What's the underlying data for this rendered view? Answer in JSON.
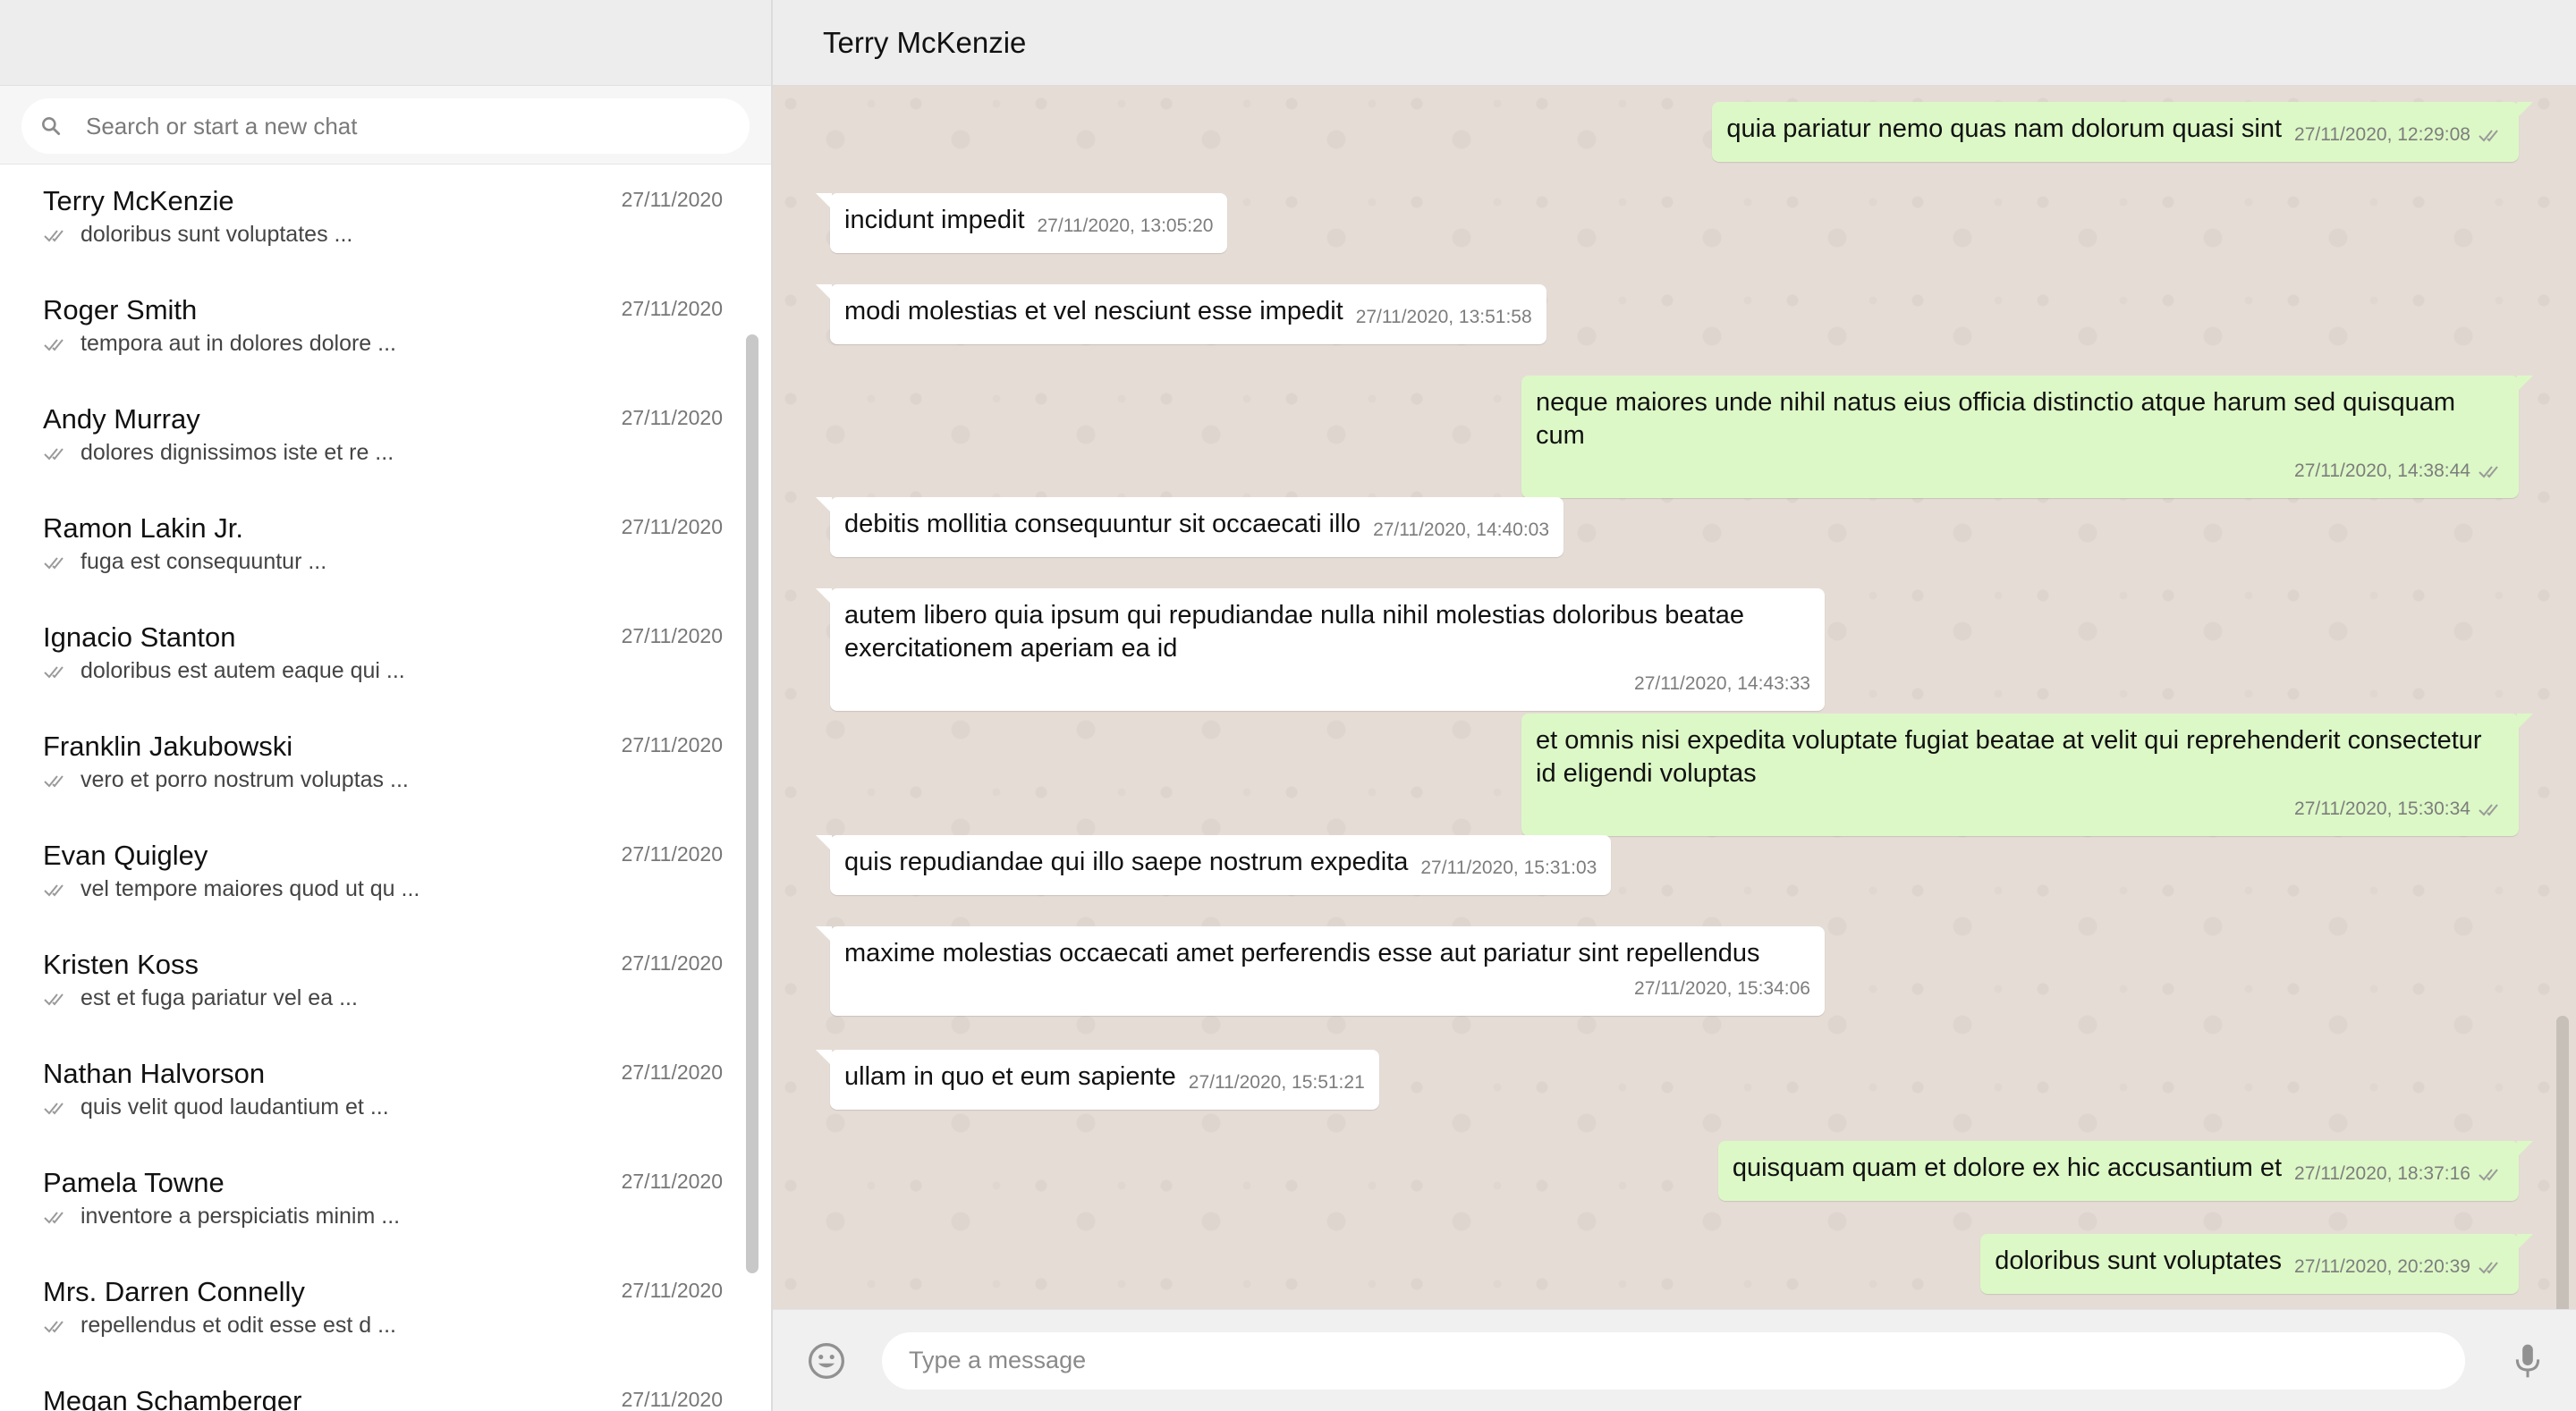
{
  "search": {
    "placeholder": "Search or start a new chat",
    "icon": "search-icon"
  },
  "chats": [
    {
      "name": "Terry McKenzie",
      "date": "27/11/2020",
      "preview": "doloribus sunt voluptates ..."
    },
    {
      "name": "Roger Smith",
      "date": "27/11/2020",
      "preview": "tempora aut in dolores dolore ..."
    },
    {
      "name": "Andy Murray",
      "date": "27/11/2020",
      "preview": "dolores dignissimos iste et re ..."
    },
    {
      "name": "Ramon Lakin Jr.",
      "date": "27/11/2020",
      "preview": "fuga est consequuntur ..."
    },
    {
      "name": "Ignacio Stanton",
      "date": "27/11/2020",
      "preview": "doloribus est autem eaque qui ..."
    },
    {
      "name": "Franklin Jakubowski",
      "date": "27/11/2020",
      "preview": "vero et porro nostrum voluptas ..."
    },
    {
      "name": "Evan Quigley",
      "date": "27/11/2020",
      "preview": "vel tempore maiores quod ut qu ..."
    },
    {
      "name": "Kristen Koss",
      "date": "27/11/2020",
      "preview": "est et fuga pariatur vel ea ..."
    },
    {
      "name": "Nathan Halvorson",
      "date": "27/11/2020",
      "preview": "quis velit quod laudantium et ..."
    },
    {
      "name": "Pamela Towne",
      "date": "27/11/2020",
      "preview": "inventore a perspiciatis minim ..."
    },
    {
      "name": "Mrs. Darren Connelly",
      "date": "27/11/2020",
      "preview": "repellendus et odit esse est d ..."
    },
    {
      "name": "Megan Schamberger",
      "date": "27/11/2020",
      "preview": ""
    }
  ],
  "conversation": {
    "title": "Terry McKenzie",
    "messages": [
      {
        "dir": "out",
        "text": "quia pariatur nemo quas nam dolorum quasi sint",
        "time": "27/11/2020, 12:29:08"
      },
      {
        "dir": "in",
        "text": "incidunt impedit",
        "time": "27/11/2020, 13:05:20"
      },
      {
        "dir": "in",
        "text": "modi molestias et vel nesciunt esse impedit",
        "time": "27/11/2020, 13:51:58"
      },
      {
        "dir": "out",
        "text": "neque maiores unde nihil natus eius officia distinctio atque harum sed quisquam cum",
        "time": "27/11/2020, 14:38:44"
      },
      {
        "dir": "in",
        "text": "debitis mollitia consequuntur sit occaecati illo",
        "time": "27/11/2020, 14:40:03"
      },
      {
        "dir": "in",
        "text": "autem libero quia ipsum qui repudiandae nulla nihil molestias doloribus beatae exercitationem aperiam ea id",
        "time": "27/11/2020, 14:43:33"
      },
      {
        "dir": "out",
        "text": "et omnis nisi expedita voluptate fugiat beatae at velit qui reprehenderit consectetur id eligendi voluptas",
        "time": "27/11/2020, 15:30:34"
      },
      {
        "dir": "in",
        "text": "quis repudiandae qui illo saepe nostrum expedita",
        "time": "27/11/2020, 15:31:03"
      },
      {
        "dir": "in",
        "text": "maxime molestias occaecati amet perferendis esse aut pariatur sint repellendus",
        "time": "27/11/2020, 15:34:06"
      },
      {
        "dir": "in",
        "text": "ullam in quo et eum sapiente",
        "time": "27/11/2020, 15:51:21"
      },
      {
        "dir": "out",
        "text": "quisquam quam et dolore ex hic accusantium et",
        "time": "27/11/2020, 18:37:16"
      },
      {
        "dir": "out",
        "text": "doloribus sunt voluptates",
        "time": "27/11/2020, 20:20:39"
      }
    ]
  },
  "composer": {
    "placeholder": "Type a message",
    "emoji_icon": "emoji-icon",
    "mic_icon": "mic-icon"
  },
  "colors": {
    "outgoing_bubble": "#dcf8c6",
    "incoming_bubble": "#ffffff",
    "chat_background": "#e5ddd5",
    "header_background": "#ededed"
  }
}
